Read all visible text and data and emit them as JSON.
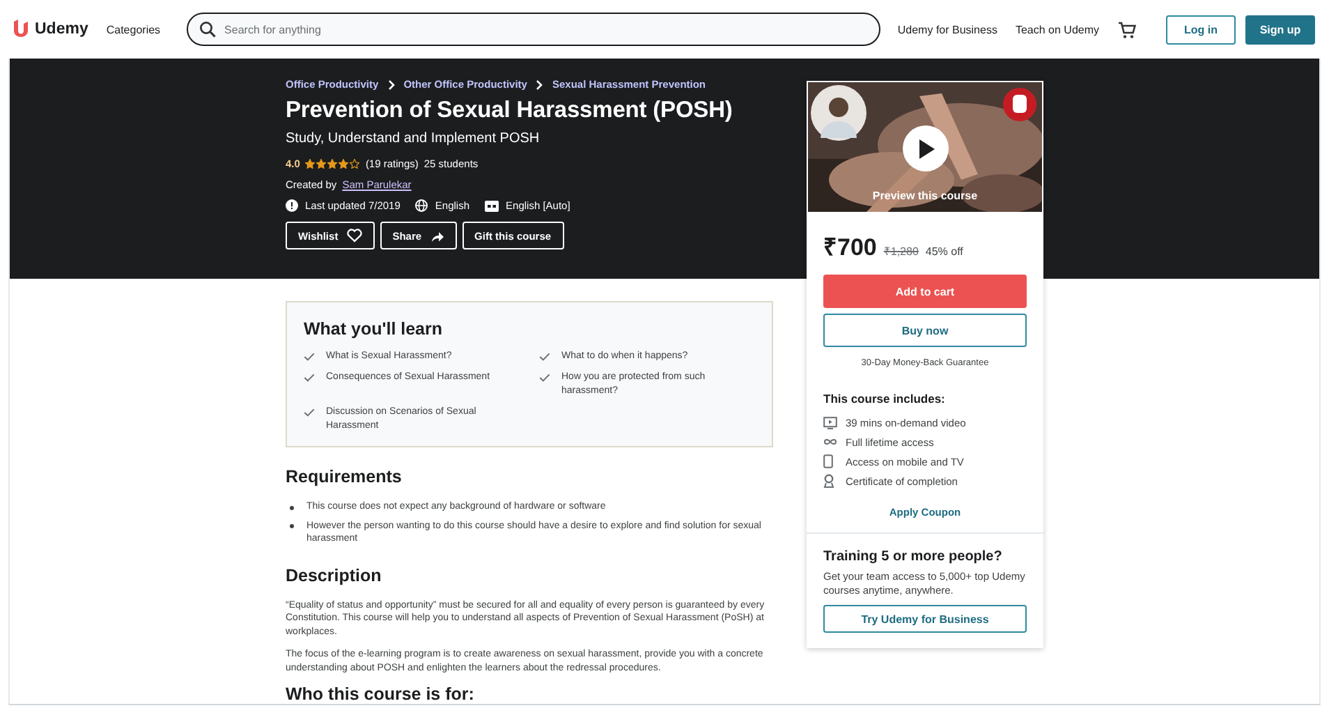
{
  "header": {
    "logo": "Udemy",
    "categories": "Categories",
    "search": {
      "placeholder": "Search for anything"
    },
    "links": [
      "Udemy for Business",
      "Teach on Udemy"
    ],
    "login": "Log in",
    "signup": "Sign up"
  },
  "hero": {
    "breadcrumbs": [
      "Office Productivity",
      "Other Office Productivity",
      "Sexual Harassment Prevention"
    ],
    "title": "Prevention of Sexual Harassment (POSH)",
    "subtitle": "Study, Understand and Implement POSH",
    "rating": "4.0",
    "stars": 4,
    "ratings_count": "(19 ratings)",
    "students": "25 students",
    "created_by": "Created by",
    "author": "Sam Parulekar",
    "meta": [
      {
        "kind": "updated",
        "text": "Last updated 7/2019"
      },
      {
        "kind": "language",
        "text": "English"
      },
      {
        "kind": "captions",
        "text": "English [Auto]"
      }
    ],
    "actions": [
      {
        "kind": "wishlist",
        "label": "Wishlist"
      },
      {
        "kind": "share",
        "label": "Share"
      },
      {
        "kind": "gift",
        "label": "Gift this course"
      }
    ]
  },
  "sidebar": {
    "preview": {
      "kind": "picture",
      "label": "Preview this course"
    },
    "price": "₹700",
    "original_price": "₹1,280",
    "discount": "45% off",
    "add_to_cart": "Add to cart",
    "buy_now": "Buy now",
    "guarantee": "30-Day Money-Back Guarantee",
    "includes_title": "This course includes:",
    "includes": [
      {
        "kind": "video",
        "text": "39 mins on-demand video"
      },
      {
        "kind": "lifetime",
        "text": "Full lifetime access"
      },
      {
        "kind": "mobile",
        "text": "Access on mobile and TV"
      },
      {
        "kind": "certificate",
        "text": "Certificate of completion"
      }
    ],
    "coupon": "Apply Coupon",
    "business": {
      "title": "Training 5 or more people?",
      "text": "Get your team access to 5,000+ top Udemy courses anytime, anywhere.",
      "button": "Try Udemy for Business"
    }
  },
  "learn": {
    "title": "What you'll learn",
    "items": [
      "What is Sexual Harassment?",
      "Consequences of Sexual Harassment",
      "Discussion on Scenarios of Sexual Harassment",
      "What to do when it happens?",
      "How you are protected from such harassment?"
    ]
  },
  "requirements": {
    "title": "Requirements",
    "items": [
      "This course does not expect any background of hardware or software",
      "However the person wanting to do this course should have a desire to explore and find solution for sexual harassment"
    ]
  },
  "description": {
    "title": "Description",
    "paragraphs": [
      "“Equality of status and opportunity” must be secured for all and equality of every person is guaranteed by every Constitution. This course will help you to understand all aspects of Prevention of Sexual Harassment (PoSH) at workplaces.",
      "The focus of the e-learning program is to create awareness on sexual harassment, provide you with a concrete understanding about POSH and enlighten the learners about the redressal procedures."
    ]
  },
  "audience": {
    "title": "Who this course is for:"
  }
}
